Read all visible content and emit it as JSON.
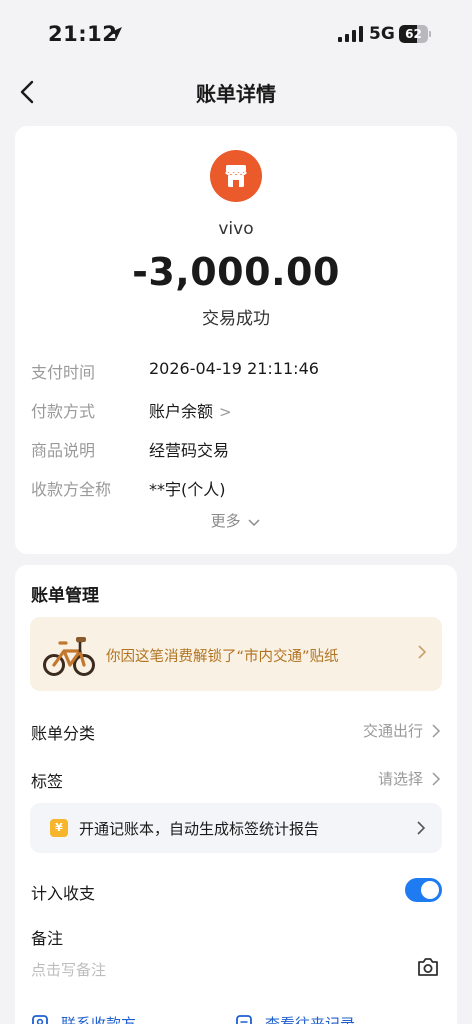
{
  "status_bar": {
    "time": "21:12",
    "network": "5G",
    "battery": "62",
    "battery_level": 0.62
  },
  "nav": {
    "title": "账单详情"
  },
  "summary": {
    "merchant_name": "vivo",
    "amount": "-3,000.00",
    "status": "交易成功",
    "details": [
      {
        "label": "支付时间",
        "value": "2026-04-19 21:11:46"
      },
      {
        "label": "付款方式",
        "value": "账户余额"
      },
      {
        "label": "商品说明",
        "value": "经营码交易"
      },
      {
        "label": "收款方全称",
        "value": "**宇(个人)"
      }
    ],
    "more_label": "更多"
  },
  "management": {
    "title": "账单管理",
    "banner_text": "你因这笔消费解锁了“市内交通”贴纸",
    "category_label": "账单分类",
    "category_value": "交通出行",
    "tag_label": "标签",
    "tag_value": "请选择",
    "tip_icon": "¥",
    "tip_text": "开通记账本，自动生成标签统计报告",
    "include_label": "计入收支",
    "include_enabled": true,
    "remark_label": "备注",
    "remark_placeholder": "点击写备注",
    "contact_label": "联系收款方",
    "history_label": "查看往来记录"
  },
  "icons": [
    "location-arrow-icon",
    "signal-icon",
    "back-arrow-icon",
    "shop-icon",
    "bicycle-icon",
    "chevron-right-icon",
    "chevron-down-icon",
    "camera-icon",
    "contact-icon",
    "records-icon"
  ],
  "colors": {
    "accent": "#1f7bf2",
    "merchant": "#ea5a2a",
    "banner_text": "#b27321",
    "link": "#1f5fcf"
  }
}
